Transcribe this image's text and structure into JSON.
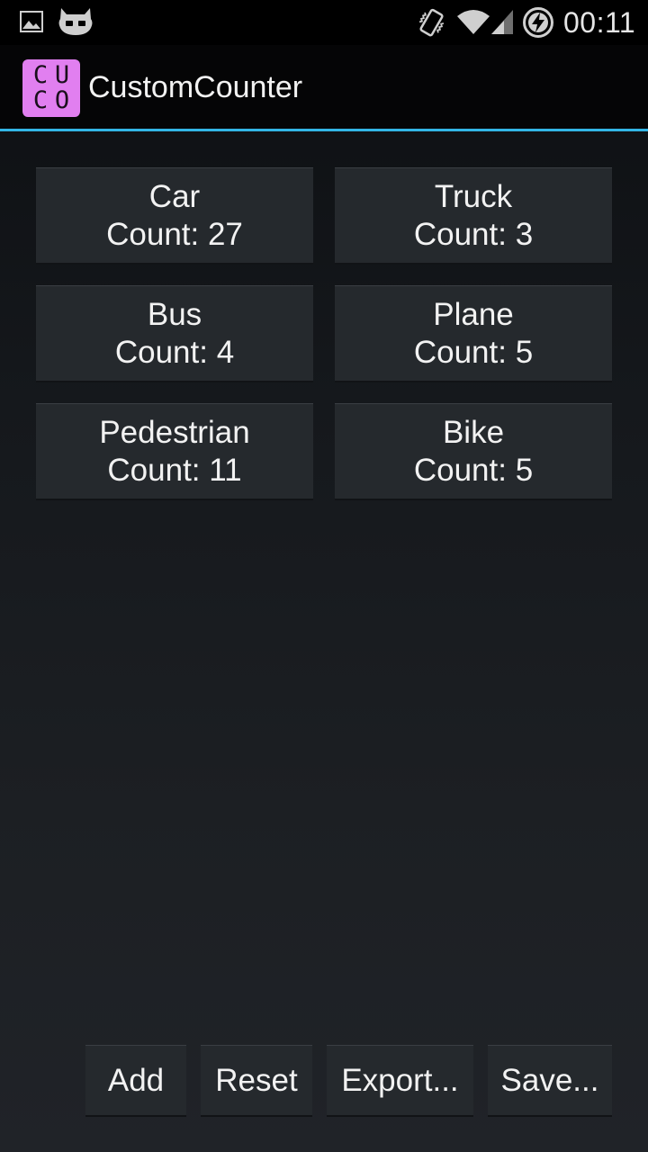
{
  "status_bar": {
    "time": "00:11",
    "icons": [
      "image-icon",
      "cyanogenmod-icon",
      "vibrate-icon",
      "wifi-icon",
      "signal-icon",
      "battery-charging-icon"
    ]
  },
  "action_bar": {
    "app_icon_letters": [
      "C",
      "U",
      "C",
      "O"
    ],
    "title": "CustomCounter",
    "accent_color": "#33b5e5",
    "icon_color": "#e17ff0"
  },
  "counters": [
    {
      "name": "Car",
      "count_text": "Count: 27"
    },
    {
      "name": "Truck",
      "count_text": "Count: 3"
    },
    {
      "name": "Bus",
      "count_text": "Count: 4"
    },
    {
      "name": "Plane",
      "count_text": "Count: 5"
    },
    {
      "name": "Pedestrian",
      "count_text": "Count: 11"
    },
    {
      "name": "Bike",
      "count_text": "Count: 5"
    }
  ],
  "bottom_buttons": {
    "add": "Add",
    "reset": "Reset",
    "export": "Export...",
    "save": "Save..."
  }
}
